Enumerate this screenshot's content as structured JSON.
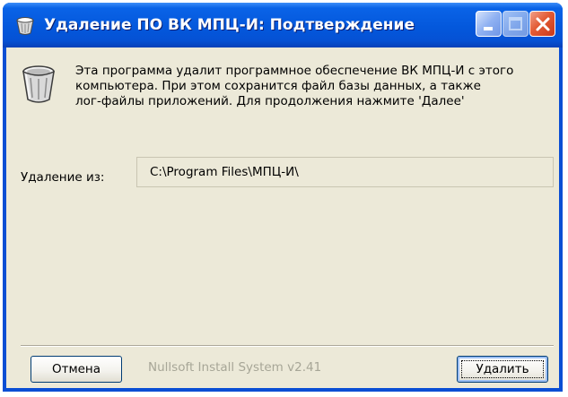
{
  "window": {
    "title": "Удаление ПО ВК МПЦ-И: Подтверждение",
    "title_icon": "uninstall-wizard-icon",
    "controls": {
      "minimize": "minimize-icon",
      "maximize": "maximize-icon",
      "close": "close-icon"
    }
  },
  "header": {
    "icon": "recycle-bin-icon",
    "lines": [
      "Эта программа удалит программное обеспечение ВК МПЦ-И с этого",
      "компьютера. При этом сохранится файл базы данных, а также",
      "лог-файлы приложений. Для продолжения нажмите 'Далее'"
    ]
  },
  "uninstall_from": {
    "label": "Удаление из:",
    "path": "C:\\Program Files\\МПЦ-И\\"
  },
  "footer": {
    "branding": "Nullsoft Install System v2.41",
    "cancel_label": "Отмена",
    "delete_label_pre": "У",
    "delete_label_mnemonic": "д",
    "delete_label_post": "алить"
  },
  "colors": {
    "titlebar": "#0458dc",
    "dialog_bg": "#ece9d8",
    "close_button": "#e35b34",
    "branding_text": "#a7a697"
  }
}
